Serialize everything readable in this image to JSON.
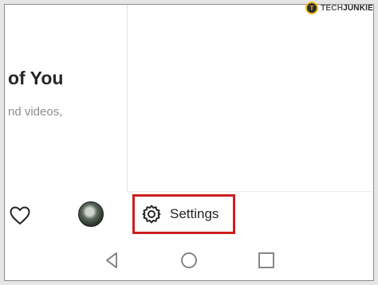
{
  "content": {
    "heading": "of You",
    "subtext": "nd videos,"
  },
  "bottom_bar": {
    "icons": [
      "heart-icon",
      "avatar"
    ]
  },
  "menu": {
    "settings_label": "Settings",
    "settings_icon": "gear-icon",
    "highlight_color": "#cc1f1f"
  },
  "nav": {
    "icons": [
      "back-icon",
      "home-icon",
      "recents-icon"
    ]
  },
  "watermark": {
    "logo_letter": "T",
    "text_tech": "TECH",
    "text_junkie": "JUNKIE"
  }
}
